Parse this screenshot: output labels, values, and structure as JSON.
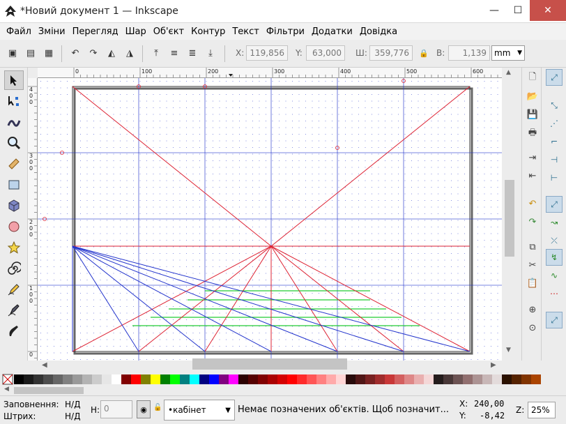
{
  "window": {
    "title": "*Новий документ 1 — Inkscape",
    "min": "—",
    "max": "☐",
    "close": "✕"
  },
  "menu": [
    "Файл",
    "Зміни",
    "Перегляд",
    "Шар",
    "Об'єкт",
    "Контур",
    "Текст",
    "Фільтри",
    "Додатки",
    "Довідка"
  ],
  "toolbar": {
    "x_label": "X:",
    "x_value": "119,856",
    "y_label": "Y:",
    "y_value": "63,000",
    "w_label": "Ш:",
    "w_value": "359,776",
    "h_label": "В:",
    "h_value": "1,139",
    "unit": "mm"
  },
  "ruler_top": [
    "0",
    "100",
    "200",
    "300",
    "400",
    "500",
    "600"
  ],
  "ruler_left": [
    {
      "d": [
        "4",
        "0",
        "0"
      ]
    },
    {
      "d": [
        "3",
        "0",
        "0"
      ]
    },
    {
      "d": [
        "2",
        "0",
        "0"
      ]
    },
    {
      "d": [
        "1",
        "0",
        "0"
      ]
    },
    {
      "d": [
        "0"
      ]
    }
  ],
  "status": {
    "fill_label": "Заповнення:",
    "fill_value": "Н/Д",
    "stroke_label": "Штрих:",
    "stroke_value": "Н/Д",
    "h_label": "Н:",
    "h_value": "0",
    "layer": "•кабінет",
    "message": "Немає позначених об'єктів. Щоб позначит...",
    "cx_label": "X:",
    "cx_value": "240,00",
    "cy_label": "Y:",
    "cy_value": "-8,42",
    "zoom_label": "Z:",
    "zoom_value": "25%"
  },
  "colors": {
    "accent_red": "#dd2233",
    "guide_blue": "#2233cc",
    "line_green": "#22cc33",
    "close_btn": "#c7504a"
  },
  "palette": [
    "#000000",
    "#1a1a1a",
    "#333333",
    "#4d4d4d",
    "#666666",
    "#808080",
    "#999999",
    "#b3b3b3",
    "#cccccc",
    "#e6e6e6",
    "#ffffff",
    "#800000",
    "#ff0000",
    "#808000",
    "#ffff00",
    "#008000",
    "#00ff00",
    "#008080",
    "#00ffff",
    "#000080",
    "#0000ff",
    "#800080",
    "#ff00ff",
    "#2b0000",
    "#550000",
    "#800000",
    "#aa0000",
    "#d40000",
    "#ff0000",
    "#ff2a2a",
    "#ff5555",
    "#ff8080",
    "#ffaaaa",
    "#ffd5d5",
    "#280b0b",
    "#501616",
    "#782121",
    "#a02c2c",
    "#c83737",
    "#d35f5f",
    "#de8787",
    "#e9afaf",
    "#f4d7d7",
    "#241c1c",
    "#483737",
    "#6c5353",
    "#916f6f",
    "#ac9393",
    "#c8b7b7",
    "#e3dbdb",
    "#2b1100",
    "#552200",
    "#803300",
    "#aa4400"
  ]
}
